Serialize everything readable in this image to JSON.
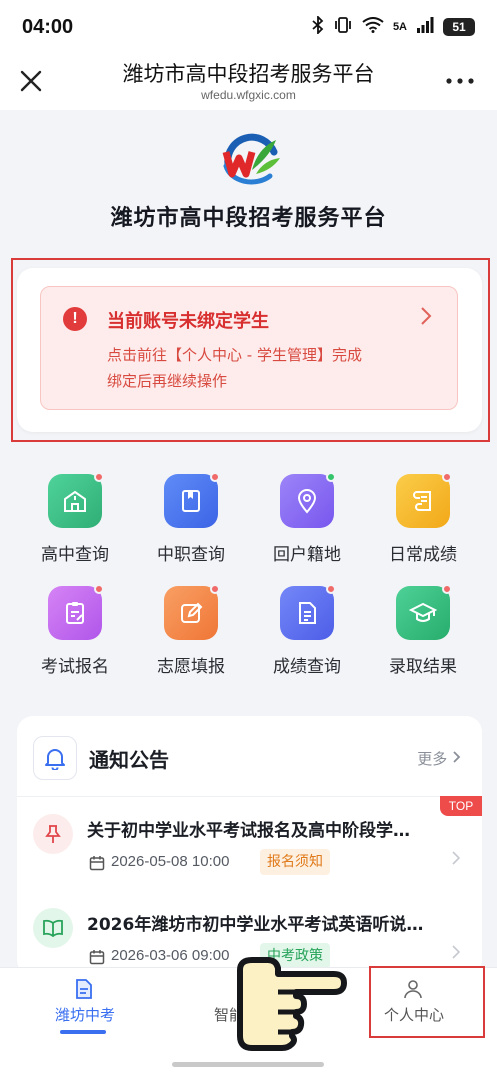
{
  "status_bar": {
    "time": "04:00",
    "signal_label": "5A",
    "battery": "51"
  },
  "title_bar": {
    "title": "潍坊市高中段招考服务平台",
    "url": "wfedu.wfgxic.com"
  },
  "header": {
    "platform_title": "潍坊市高中段招考服务平台"
  },
  "alert": {
    "title": "当前账号未绑定学生",
    "line1": "点击前往【个人中心 - 学生管理】完成",
    "line2": "绑定后再继续操作"
  },
  "grid": {
    "items": [
      {
        "label": "高中查询",
        "icon": "school-icon",
        "color": "#38c08a",
        "dot": "#f06a6a"
      },
      {
        "label": "中职查询",
        "icon": "book-icon",
        "color": "#4a78f0",
        "dot": "#f06a6a"
      },
      {
        "label": "回户籍地",
        "icon": "location-pin-icon",
        "color": "#8a6cf5",
        "dot": "#34c46c"
      },
      {
        "label": "日常成绩",
        "icon": "scroll-icon",
        "color": "#f5b92a",
        "dot": "#f06a6a"
      },
      {
        "label": "考试报名",
        "icon": "clipboard-edit-icon",
        "color": "#c46af0",
        "dot": "#f06a6a"
      },
      {
        "label": "志愿填报",
        "icon": "pencil-square-icon",
        "color": "#f5884a",
        "dot": "#f06a6a"
      },
      {
        "label": "成绩查询",
        "icon": "document-icon",
        "color": "#5a6ef0",
        "dot": "#f06a6a"
      },
      {
        "label": "录取结果",
        "icon": "graduation-cap-icon",
        "color": "#35c07a",
        "dot": "#f06a6a"
      }
    ]
  },
  "notices": {
    "title": "通知公告",
    "more": "更多",
    "top_badge": "TOP",
    "items": [
      {
        "title": "关于初中学业水平考试报名及高中阶段学…",
        "date": "2026-05-08 10:00",
        "tag": "报名须知",
        "tag_color": "#e07a1a",
        "tag_bg": "#fdf0e1",
        "icon": "pin-icon"
      },
      {
        "title": "2026年潍坊市初中学业水平考试英语听说…",
        "date": "2026-03-06 09:00",
        "tag": "中考政策",
        "tag_color": "#27a35a",
        "tag_bg": "#e3f6ea",
        "icon": "open-book-icon"
      }
    ]
  },
  "bottom_nav": {
    "items": [
      {
        "label": "潍坊中考",
        "active": true
      },
      {
        "label": "智能",
        "active": false
      },
      {
        "label": "个人中心",
        "active": false
      }
    ]
  },
  "colors": {
    "accent": "#3a6ff0",
    "alert_red": "#d83030",
    "highlight": "#d93a3a"
  }
}
